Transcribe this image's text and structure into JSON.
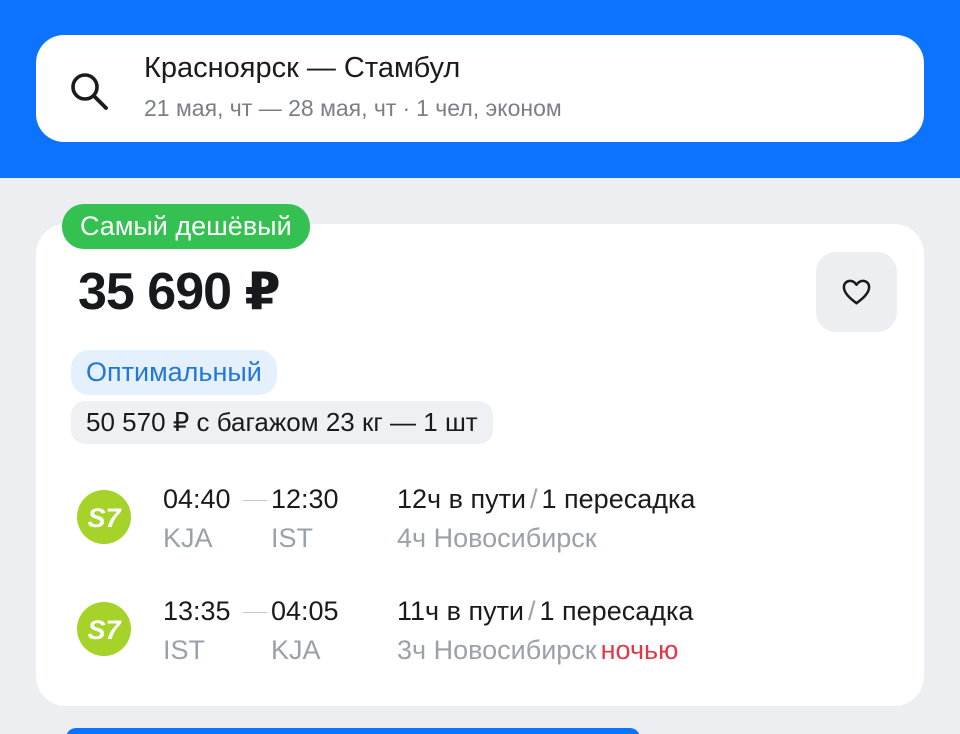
{
  "search": {
    "route": "Красноярск — Стамбул",
    "dates": "21 мая, чт — 28 мая, чт",
    "separator": "·",
    "passengers": "1 чел, эконом"
  },
  "offer": {
    "badge": "Самый дешёвый",
    "price": "35 690 ₽",
    "tag_optimal": "Оптимальный",
    "baggage": "50 570 ₽ с багажом 23 кг — 1 шт",
    "segments": [
      {
        "airline_logo_text": "S7",
        "depart_time": "04:40",
        "arrive_time": "12:30",
        "depart_code": "KJA",
        "arrive_code": "IST",
        "duration": "12ч в пути",
        "slash": "/",
        "transfers": "1 пересадка",
        "stop_info": "4ч Новосибирск",
        "stop_note": ""
      },
      {
        "airline_logo_text": "S7",
        "depart_time": "13:35",
        "arrive_time": "04:05",
        "depart_code": "IST",
        "arrive_code": "KJA",
        "duration": "11ч в пути",
        "slash": "/",
        "transfers": "1 пересадка",
        "stop_info": "3ч Новосибирск",
        "stop_note": "ночью"
      }
    ]
  },
  "colors": {
    "brand_blue": "#0c73fe",
    "cheapest_green": "#35c152",
    "s7_lime": "#a6d32a",
    "night_red": "#e2384a"
  },
  "icons": {
    "search": "search-icon",
    "favorite": "heart-icon",
    "airline": "s7-logo-icon"
  }
}
